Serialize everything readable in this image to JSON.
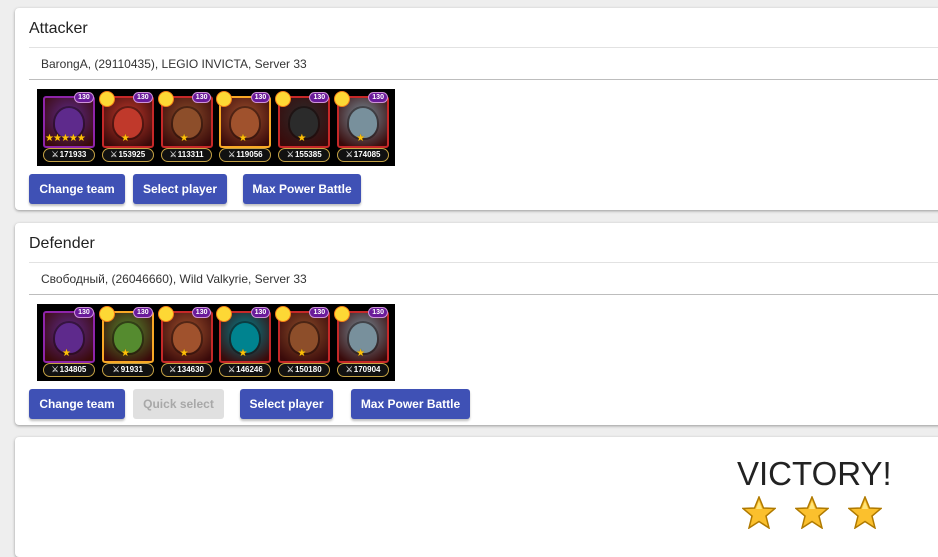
{
  "attacker": {
    "title": "Attacker",
    "player": "BarongA, (29110435), LEGIO INVICTA, Server 33",
    "heroes": [
      {
        "level": "130",
        "power": "171933",
        "stars": "★★★★★",
        "color": "#5e2a8c",
        "frame": "purple"
      },
      {
        "level": "130",
        "power": "153925",
        "stars": "★",
        "color": "#c0392b",
        "frame": "red"
      },
      {
        "level": "130",
        "power": "113311",
        "stars": "★",
        "color": "#8d4e2a",
        "frame": "red"
      },
      {
        "level": "130",
        "power": "119056",
        "stars": "★",
        "color": "#a0522d",
        "frame": "orange"
      },
      {
        "level": "130",
        "power": "155385",
        "stars": "★",
        "color": "#2b2b2b",
        "frame": "red"
      },
      {
        "level": "130",
        "power": "174085",
        "stars": "★",
        "color": "#78909c",
        "frame": "red"
      }
    ],
    "buttons": {
      "change_team": "Change team",
      "select_player": "Select player",
      "max_power": "Max Power Battle"
    }
  },
  "defender": {
    "title": "Defender",
    "player": "Свободный, (26046660), Wild Valkyrie, Server 33",
    "heroes": [
      {
        "level": "130",
        "power": "134805",
        "stars": "★",
        "color": "#5e2a8c",
        "frame": "purple"
      },
      {
        "level": "130",
        "power": "91931",
        "stars": "★",
        "color": "#558b2f",
        "frame": "orange"
      },
      {
        "level": "130",
        "power": "134630",
        "stars": "★",
        "color": "#a0522d",
        "frame": "red"
      },
      {
        "level": "130",
        "power": "146246",
        "stars": "★",
        "color": "#00838f",
        "frame": "red"
      },
      {
        "level": "130",
        "power": "150180",
        "stars": "★",
        "color": "#8d4e2a",
        "frame": "red"
      },
      {
        "level": "130",
        "power": "170904",
        "stars": "★",
        "color": "#78909c",
        "frame": "red"
      }
    ],
    "buttons": {
      "change_team": "Change team",
      "quick_select": "Quick select",
      "select_player": "Select player",
      "max_power": "Max Power Battle"
    }
  },
  "result": {
    "text": "VICTORY!",
    "stars": 3,
    "star_color": "#fbc02d"
  }
}
